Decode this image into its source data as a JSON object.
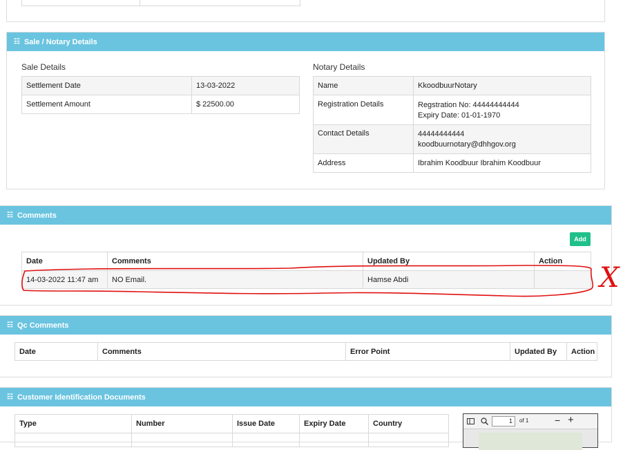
{
  "sale_notary": {
    "title": "Sale / Notary Details",
    "sale_heading": "Sale Details",
    "sale_rows": [
      {
        "label": "Settlement Date",
        "value": "13-03-2022"
      },
      {
        "label": "Settlement Amount",
        "value": "$ 22500.00"
      }
    ],
    "notary_heading": "Notary Details",
    "notary_rows": [
      {
        "label": "Name",
        "value1": "KkoodbuurNotary",
        "value2": ""
      },
      {
        "label": "Registration Details",
        "value1": "Regstration No: 44444444444",
        "value2": "Expiry Date: 01-01-1970"
      },
      {
        "label": "Contact Details",
        "value1": "44444444444",
        "value2": "koodbuurnotary@dhhgov.org"
      },
      {
        "label": "Address",
        "value1": "Ibrahim Koodbuur Ibrahim Koodbuur",
        "value2": ""
      }
    ]
  },
  "comments": {
    "title": "Comments",
    "add_label": "Add",
    "columns": [
      "Date",
      "Comments",
      "Updated By",
      "Action"
    ],
    "rows": [
      {
        "date": "14-03-2022 11:47 am",
        "comment": "NO Email.",
        "updated_by": "Hamse Abdi",
        "action": ""
      }
    ],
    "annotation_mark": "X",
    "annotation_color": "#e01010"
  },
  "qc_comments": {
    "title": "Qc Comments",
    "columns": [
      "Date",
      "Comments",
      "Error Point",
      "Updated By",
      "Action"
    ]
  },
  "customer_docs": {
    "title": "Customer Identification Documents",
    "columns": [
      "Type",
      "Number",
      "Issue Date",
      "Expiry Date",
      "Country"
    ],
    "viewer": {
      "page_value": "1",
      "page_total": "of 1",
      "zoom_out": "−",
      "zoom_in": "+"
    }
  },
  "colors": {
    "panel_header": "#6ac4e0",
    "add_button": "#20c08a"
  }
}
